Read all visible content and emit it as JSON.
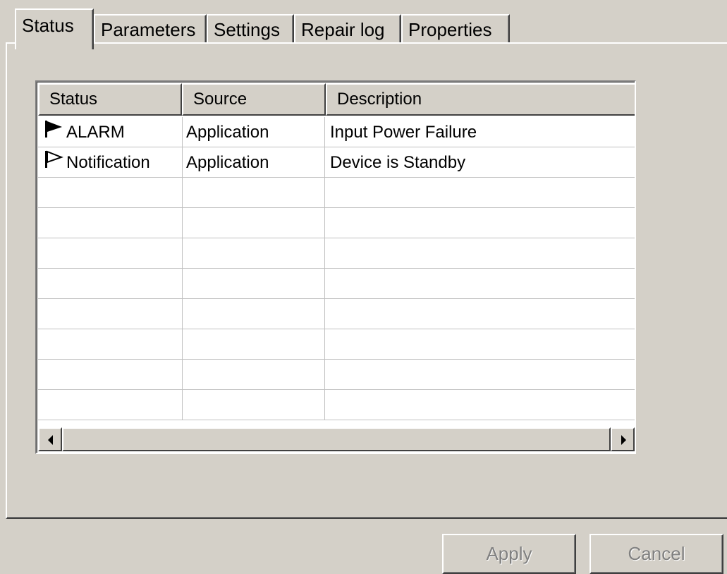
{
  "tabs": [
    {
      "label": "Status"
    },
    {
      "label": "Parameters"
    },
    {
      "label": "Settings"
    },
    {
      "label": "Repair log"
    },
    {
      "label": "Properties"
    }
  ],
  "list": {
    "columns": [
      {
        "label": "Status"
      },
      {
        "label": "Source"
      },
      {
        "label": "Description"
      }
    ],
    "rows": [
      {
        "status": "ALARM",
        "status_icon": "flag-filled-icon",
        "source": "Application",
        "description": "Input Power Failure"
      },
      {
        "status": "Notification",
        "status_icon": "flag-outline-icon",
        "source": "Application",
        "description": "Device is Standby"
      }
    ]
  },
  "buttons": {
    "apply": "Apply",
    "cancel": "Cancel"
  }
}
